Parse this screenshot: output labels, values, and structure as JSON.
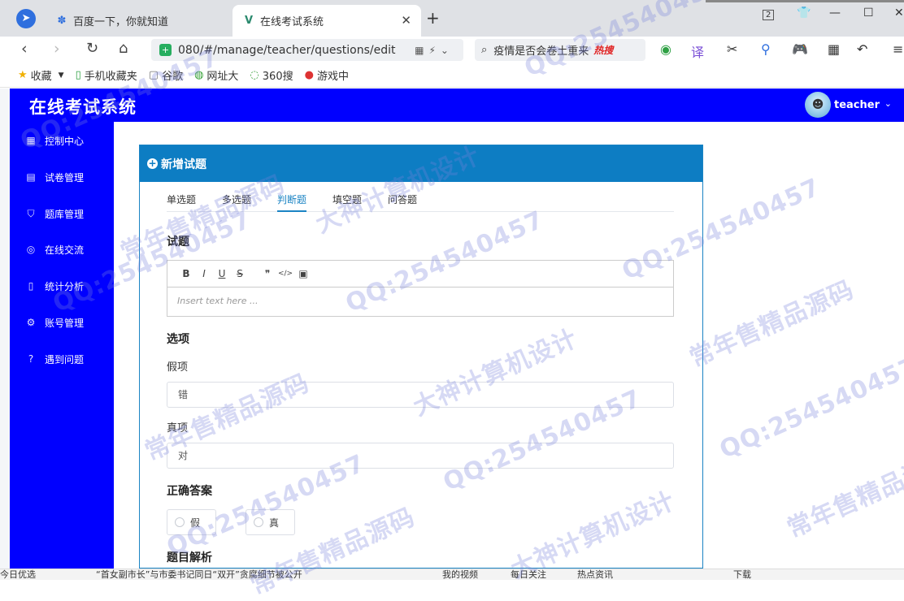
{
  "browser": {
    "tabs": [
      {
        "title": "百度一下，你就知道"
      },
      {
        "title": "在线考试系统"
      }
    ],
    "new_tab_icon": "+",
    "url": "080/#/manage/teacher/questions/edit",
    "search_text": "疫情是否会卷土重来",
    "search_badge": "热搜",
    "window_badge": "2",
    "bookmarks": [
      {
        "label": "收藏",
        "icon": "star-icon"
      },
      {
        "label": "手机收藏夹",
        "icon": "phone-icon"
      },
      {
        "label": "谷歌",
        "icon": "page-icon"
      },
      {
        "label": "网址大",
        "icon": "globe-icon"
      },
      {
        "label": "360搜",
        "icon": "search-360-icon"
      },
      {
        "label": "游戏中",
        "icon": "game-icon"
      }
    ]
  },
  "app": {
    "title": "在线考试系统",
    "user": "teacher",
    "accent": "#0000ff"
  },
  "sidebar": {
    "items": [
      {
        "label": "控制中心",
        "icon": "grid-icon"
      },
      {
        "label": "试卷管理",
        "icon": "document-icon"
      },
      {
        "label": "题库管理",
        "icon": "bag-icon"
      },
      {
        "label": "在线交流",
        "icon": "headset-icon"
      },
      {
        "label": "统计分析",
        "icon": "phone-icon"
      },
      {
        "label": "账号管理",
        "icon": "gear-icon"
      },
      {
        "label": "遇到问题",
        "icon": "question-icon"
      }
    ]
  },
  "card": {
    "title": "新增试题",
    "header_color": "#0d7dc3",
    "tabs": [
      "单选题",
      "多选题",
      "判断题",
      "填空题",
      "问答题"
    ],
    "active_tab": "判断题",
    "question_label": "试题",
    "editor_toolbar": [
      "B",
      "I",
      "U",
      "S",
      "❞",
      "</>",
      "▣"
    ],
    "editor_placeholder": "Insert text here ...",
    "options_label": "选项",
    "false_label": "假项",
    "false_value": "错",
    "true_label": "真项",
    "true_value": "对",
    "answer_label": "正确答案",
    "answer_options": [
      "假",
      "真"
    ],
    "analysis_label": "题目解析"
  },
  "statusbar": {
    "items": [
      "今日优选",
      "“首女副市长”与市委书记同日“双开”贪腐细节被公开",
      "我的视频",
      "每日关注",
      "热点资讯",
      "下载"
    ]
  },
  "watermarks": [
    "QQ:254540457",
    "大神计算机设计",
    "常年售精品源码"
  ]
}
